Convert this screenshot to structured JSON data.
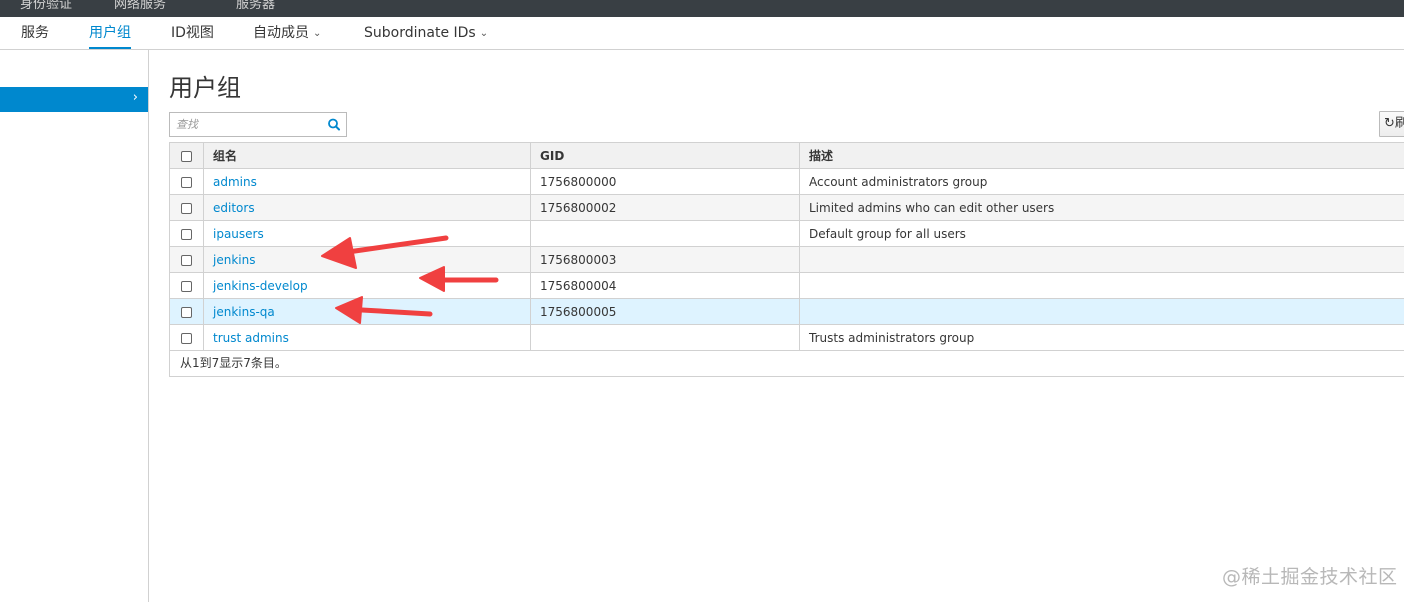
{
  "top_bar": {
    "items": [
      "身份验证",
      "网络服务",
      "服务器"
    ]
  },
  "nav": {
    "tabs": [
      {
        "label": "服务",
        "active": false
      },
      {
        "label": "用户组",
        "active": true
      },
      {
        "label": "ID视图",
        "active": false
      },
      {
        "label": "自动成员",
        "active": false,
        "dropdown": true
      },
      {
        "label": "Subordinate IDs",
        "active": false,
        "dropdown": true
      }
    ]
  },
  "sidebar": {
    "selected_arrow": "chevron-right-icon"
  },
  "page": {
    "title": "用户组"
  },
  "search": {
    "placeholder": "查找",
    "icon": "search-icon"
  },
  "toolbar": {
    "refresh_label": "刷新",
    "refresh_icon": "refresh-icon"
  },
  "table": {
    "columns": [
      "组名",
      "GID",
      "描述"
    ],
    "rows": [
      {
        "name": "admins",
        "gid": "1756800000",
        "description": "Account administrators group"
      },
      {
        "name": "editors",
        "gid": "1756800002",
        "description": "Limited admins who can edit other users"
      },
      {
        "name": "ipausers",
        "gid": "",
        "description": "Default group for all users"
      },
      {
        "name": "jenkins",
        "gid": "1756800003",
        "description": ""
      },
      {
        "name": "jenkins-develop",
        "gid": "1756800004",
        "description": ""
      },
      {
        "name": "jenkins-qa",
        "gid": "1756800005",
        "description": ""
      },
      {
        "name": "trust admins",
        "gid": "",
        "description": "Trusts administrators group"
      }
    ],
    "summary": "从1到7显示7条目。"
  },
  "annotation": {
    "arrow_color": "#f04040"
  },
  "watermark": "@稀土掘金技术社区",
  "colors": {
    "accent": "#0088ce",
    "topbar": "#393f44",
    "hover_row": "#def3ff"
  }
}
